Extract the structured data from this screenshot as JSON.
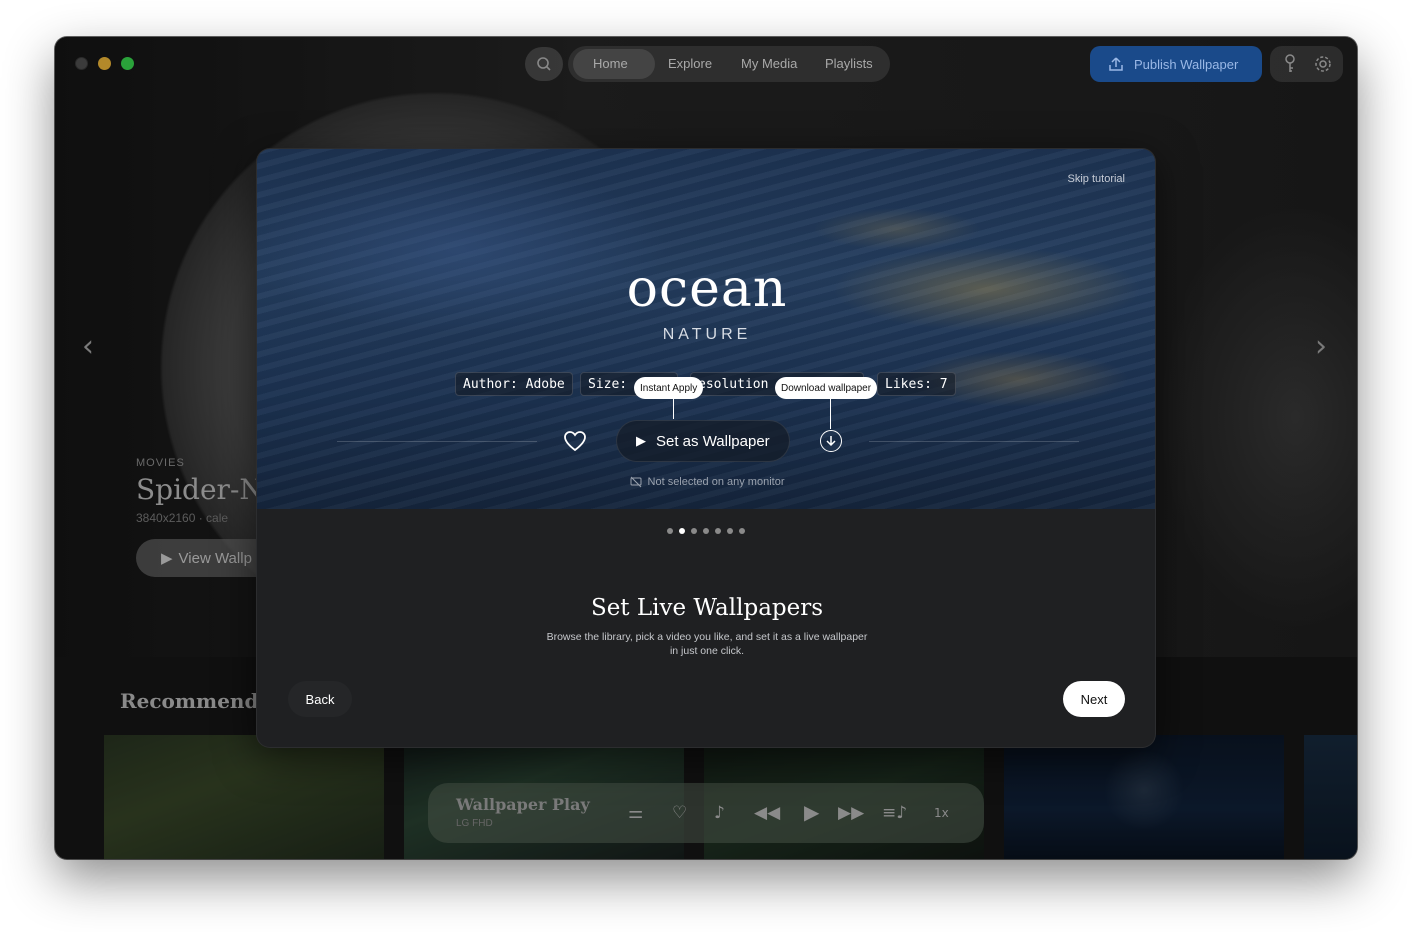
{
  "nav": {
    "items": [
      "Home",
      "Explore",
      "My Media",
      "Playlists"
    ],
    "publish_label": "Publish Wallpaper"
  },
  "hero": {
    "category": "MOVIES",
    "title": "Spider-No",
    "meta": "3840x2160 · cale",
    "view_label": "View Wallp"
  },
  "recommended": {
    "title": "Recommended"
  },
  "player": {
    "title": "Wallpaper Play",
    "subtitle": "LG FHD",
    "speed": "1x"
  },
  "tutorial": {
    "skip_label": "Skip tutorial",
    "wallpaper_title": "ocean",
    "wallpaper_category": "NATURE",
    "chips": {
      "author": "Author: Adobe",
      "size": "Size: ",
      "resolution": "esolution",
      "likes": "Likes: 7"
    },
    "tooltip_instant": "Instant Apply",
    "tooltip_download": "Download wallpaper",
    "set_button": "Set as Wallpaper",
    "monitor_status": "Not selected on any monitor",
    "step_title": "Set Live Wallpapers",
    "step_description": "Browse the library, pick a video you like, and set it as a live wallpaper in just one click.",
    "back_label": "Back",
    "next_label": "Next",
    "steps_total": 7,
    "current_step": 2
  },
  "colors": {
    "accent": "#1a4a8a",
    "modal_bg": "#1f2022"
  }
}
